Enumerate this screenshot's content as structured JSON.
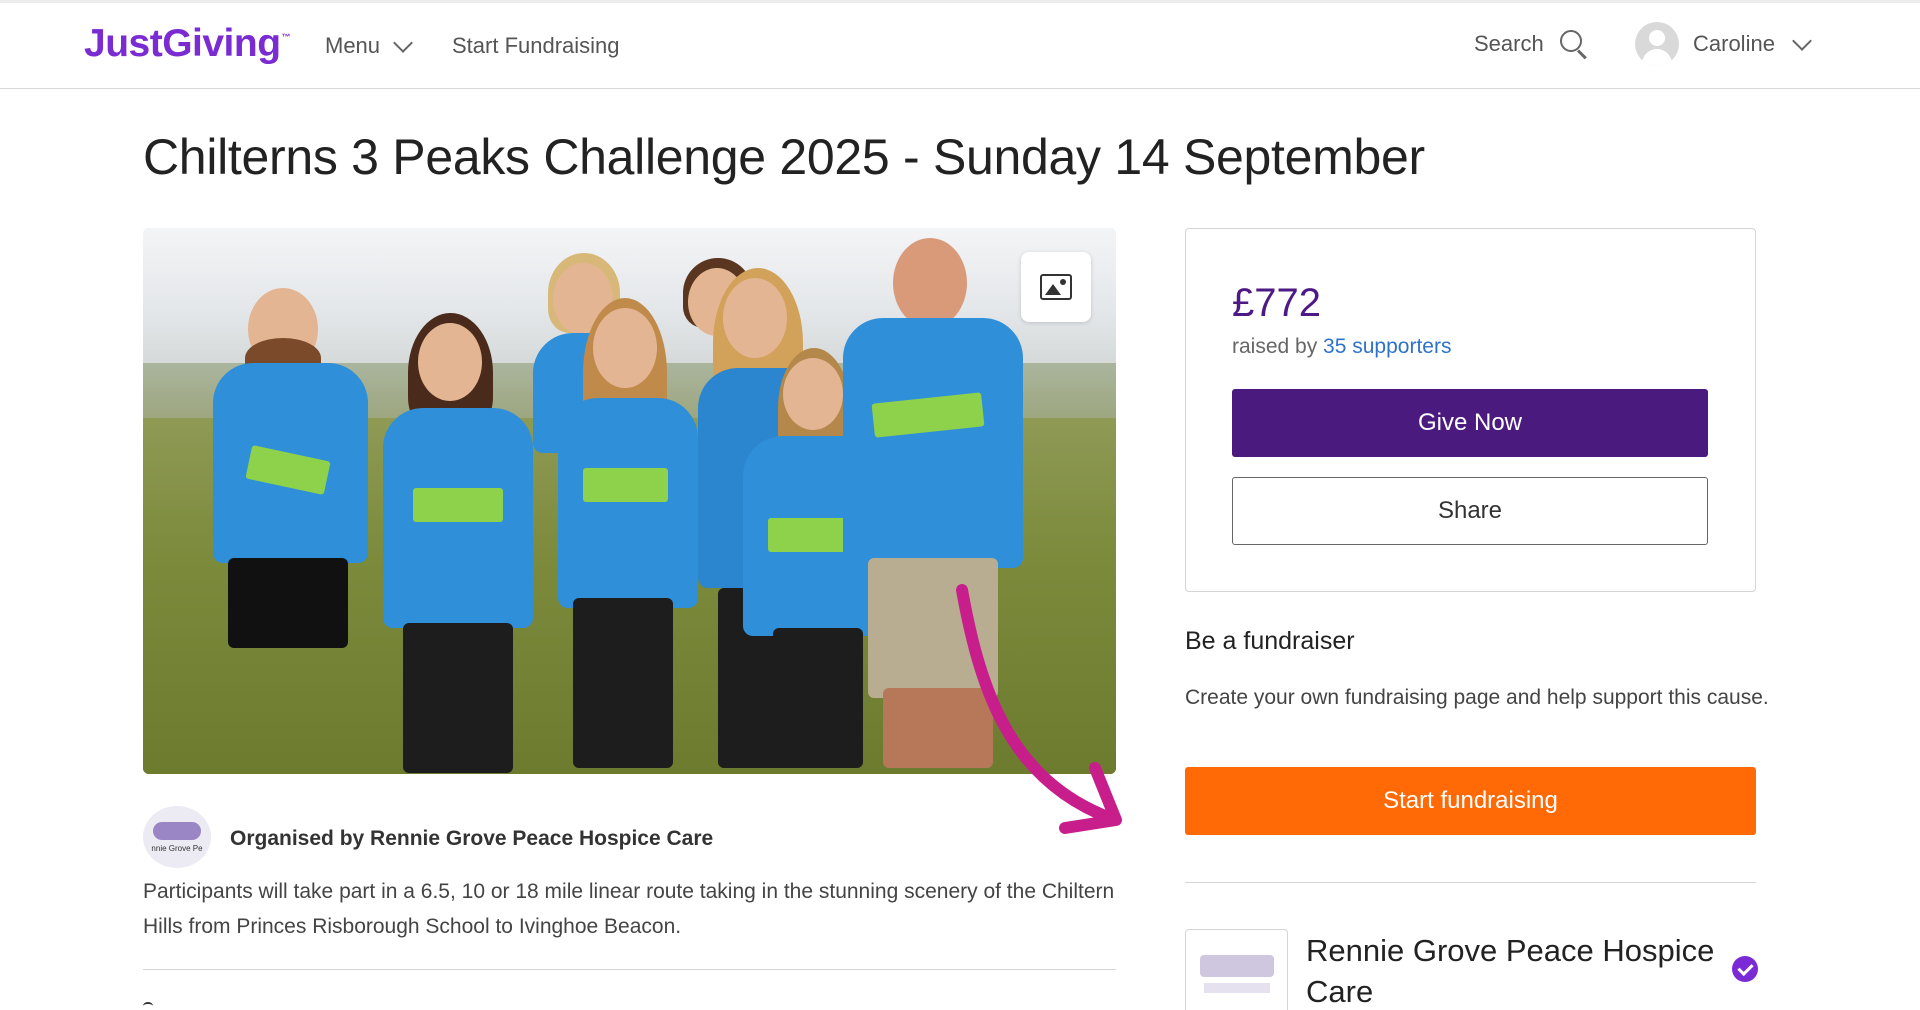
{
  "header": {
    "logo": "JustGiving",
    "logo_tm": "™",
    "menu_label": "Menu",
    "start_label": "Start Fundraising",
    "search_label": "Search",
    "user_name": "Caroline"
  },
  "page": {
    "title": "Chilterns 3 Peaks Challenge 2025 - Sunday 14 September"
  },
  "organiser": {
    "logo_text": "nnie Grove Pe",
    "label": "Organised by Rennie Grove Peace Hospice Care",
    "description": "Participants will take part in a 6.5, 10 or 18 mile linear route taking in the stunning scenery of the Chiltern Hills from Princes Risborough School to Ivinghoe Beacon."
  },
  "donation": {
    "amount": "£772",
    "raised_prefix": "raised by ",
    "supporters_link": "35 supporters",
    "give_label": "Give Now",
    "share_label": "Share"
  },
  "fundraiser": {
    "heading": "Be a fundraiser",
    "text": "Create your own fundraising page and help support this cause.",
    "start_label": "Start fundraising"
  },
  "charity": {
    "name": "Rennie Grove Peace Hospice Care"
  },
  "colors": {
    "brand": "#7a2bd2",
    "give_button": "#4b1a7f",
    "start_button": "#ff6a07",
    "link": "#2f73c9",
    "arrow": "#c81e8c"
  },
  "icons": [
    "chevron-down-icon",
    "search-icon",
    "avatar-icon",
    "photo-gallery-icon",
    "verified-badge-icon",
    "arrow-annotation-icon"
  ]
}
